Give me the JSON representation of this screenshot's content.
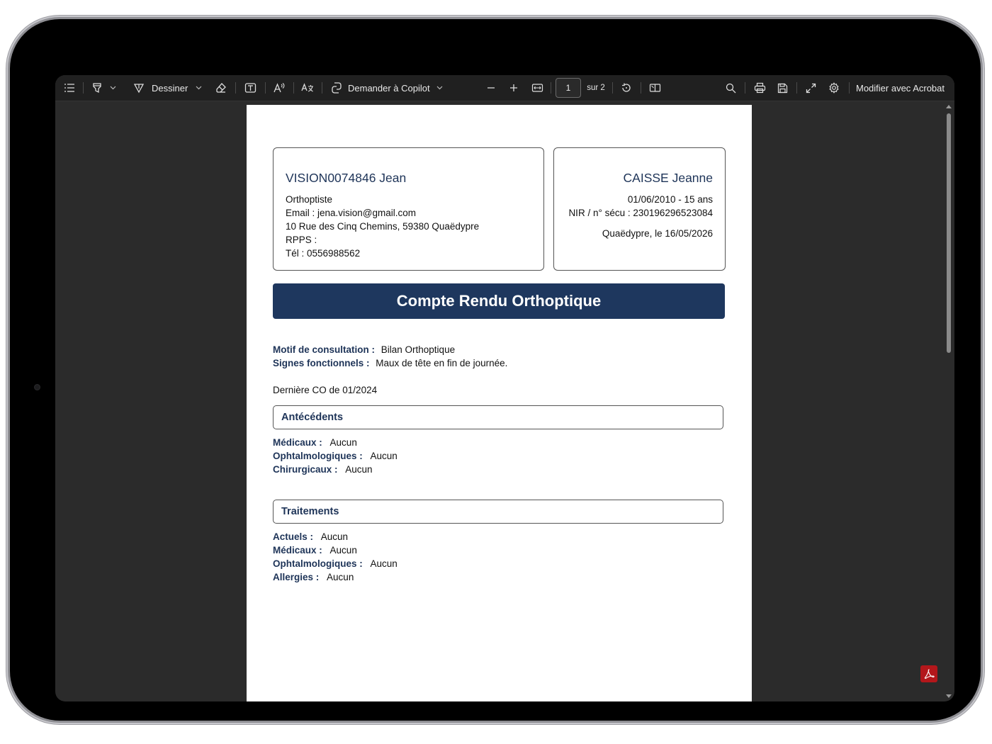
{
  "toolbar": {
    "draw_label": "Dessiner",
    "copilot_label": "Demander à Copilot",
    "page_current": "1",
    "page_total": "sur 2",
    "acrobat_label": "Modifier avec Acrobat"
  },
  "document": {
    "practitioner": {
      "name": "VISION0074846 Jean",
      "title": "Orthoptiste",
      "email": "Email : jena.vision@gmail.com",
      "address": "10 Rue des Cinq Chemins, 59380 Quaëdypre",
      "rpps": "RPPS :",
      "tel": "Tél : 0556988562"
    },
    "patient": {
      "name": "CAISSE Jeanne",
      "birth": "01/06/2010 - 15 ans",
      "nir": "NIR / n° sécu : 230196296523084",
      "place_date": "Quaëdypre, le 16/05/2026"
    },
    "title": "Compte Rendu Orthoptique",
    "consultation": {
      "motif_label": "Motif de consultation :",
      "motif_value": "Bilan Orthoptique",
      "signes_label": "Signes fonctionnels :",
      "signes_value": "Maux de tête en fin de journée."
    },
    "last_co": "Dernière CO de 01/2024",
    "antecedents": {
      "heading": "Antécédents",
      "rows": [
        {
          "label": "Médicaux :",
          "value": "Aucun"
        },
        {
          "label": "Ophtalmologiques :",
          "value": "Aucun"
        },
        {
          "label": "Chirurgicaux :",
          "value": "Aucun"
        }
      ]
    },
    "traitements": {
      "heading": "Traitements",
      "rows": [
        {
          "label": "Actuels :",
          "value": "Aucun"
        },
        {
          "label": "Médicaux :",
          "value": "Aucun"
        },
        {
          "label": "Ophtalmologiques :",
          "value": "Aucun"
        },
        {
          "label": "Allergies :",
          "value": "Aucun"
        }
      ]
    }
  }
}
